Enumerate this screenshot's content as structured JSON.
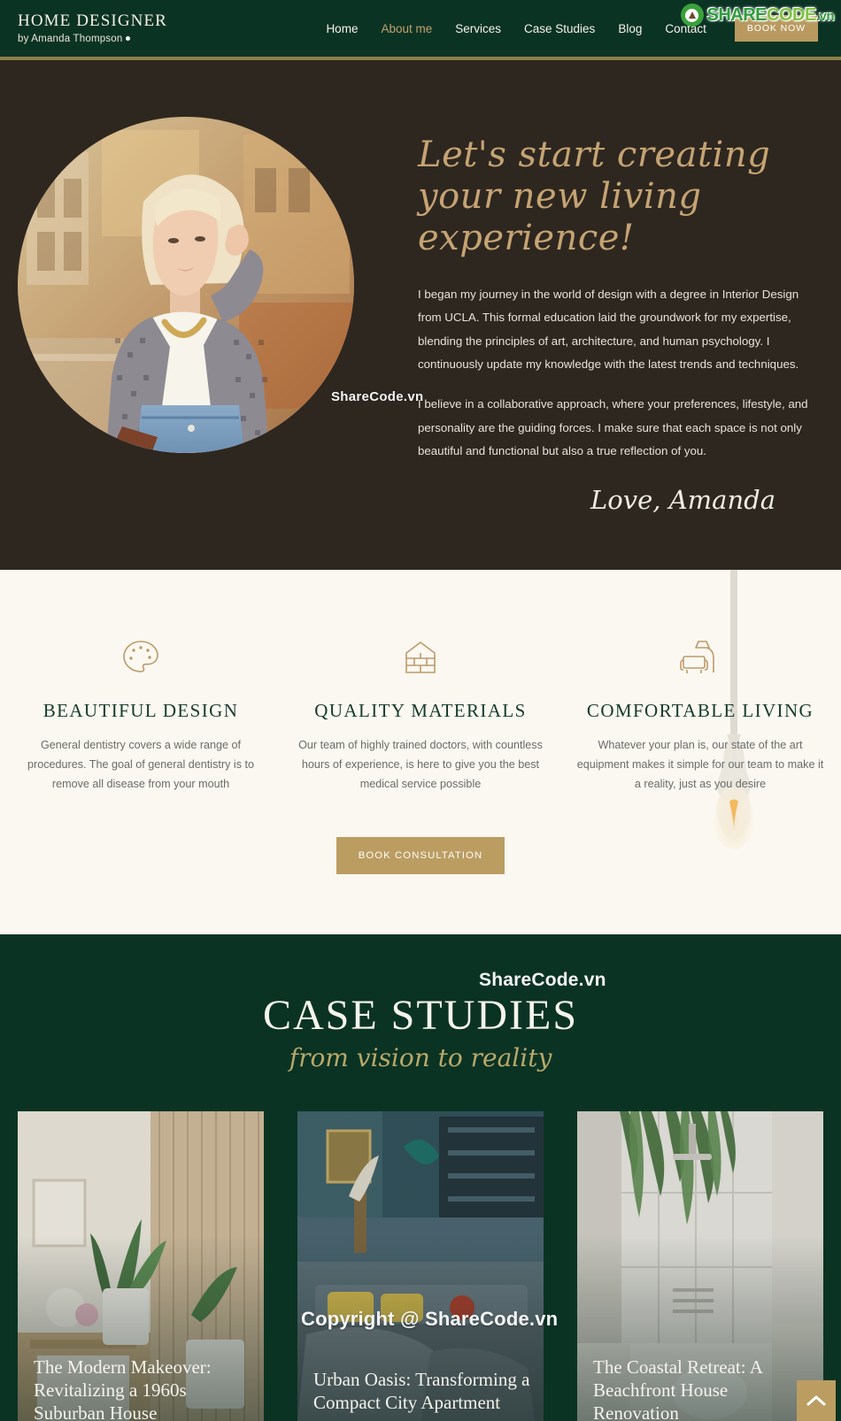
{
  "header": {
    "brand_title": "HOME DESIGNER",
    "brand_subtitle": "by Amanda Thompson",
    "nav": [
      {
        "label": "Home",
        "active": false
      },
      {
        "label": "About me",
        "active": true
      },
      {
        "label": "Services",
        "active": false
      },
      {
        "label": "Case Studies",
        "active": false
      },
      {
        "label": "Blog",
        "active": false
      },
      {
        "label": "Contact",
        "active": false
      }
    ],
    "cta_label": "BOOK NOW",
    "accent_green": "#0b3324",
    "accent_gold": "#b89a60",
    "divider_gold": "#8d8047"
  },
  "watermarks": {
    "logo_share": "SHARE",
    "logo_code": "CODE",
    "logo_vn": ".vn",
    "hero_text": "ShareCode.vn",
    "case_text": "ShareCode.vn",
    "copyright_text": "Copyright @ ShareCode.vn"
  },
  "hero": {
    "headline": "Let's start creating your new living experience!",
    "paragraph_1": "I began my journey in the world of design with a degree in Interior Design from UCLA. This formal education laid the groundwork for my expertise, blending the principles of art, architecture, and human psychology. I continuously update my knowledge with the latest trends and techniques.",
    "paragraph_2": "I believe in a collaborative approach, where your preferences, lifestyle, and personality are the guiding forces. I make sure that each space is not only beautiful and functional but also a true reflection of you.",
    "signature": "Love, Amanda",
    "background": "#2e2720",
    "headline_color": "#c5a373",
    "portrait_alt": "Portrait of Amanda Thompson"
  },
  "features": {
    "items": [
      {
        "icon": "palette-icon",
        "title": "BEAUTIFUL DESIGN",
        "text": "General dentistry covers a wide range of procedures. The goal of general dentistry is to remove all disease from your mouth"
      },
      {
        "icon": "brick-house-icon",
        "title": "QUALITY MATERIALS",
        "text": "Our team of highly trained doctors, with countless hours of experience, is here to give you the best medical service possible"
      },
      {
        "icon": "armchair-lamp-icon",
        "title": "COMFORTABLE LIVING",
        "text": "Whatever your plan is, our state of the art equipment makes it simple for our team to make it a reality, just as you desire"
      }
    ],
    "cta_label": "BOOK CONSULTATION",
    "background": "#fbf8f1",
    "icon_color": "#bd9a6b",
    "title_color": "#163b2c"
  },
  "case_studies": {
    "heading": "CASE STUDIES",
    "subheading": "from vision to reality",
    "background": "#0b3324",
    "cards": [
      {
        "title": "The Modern Makeover: Revitalizing a 1960s Suburban House"
      },
      {
        "title": "Urban Oasis: Transforming a Compact City Apartment"
      },
      {
        "title": "The Coastal Retreat: A Beachfront House Renovation"
      }
    ]
  },
  "footer_controls": {
    "scroll_top_icon": "chevron-up-icon"
  }
}
